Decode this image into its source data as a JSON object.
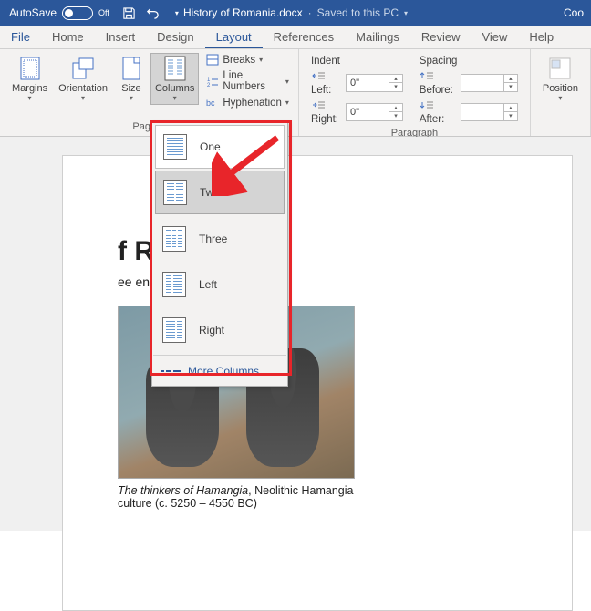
{
  "titlebar": {
    "autosave_label": "AutoSave",
    "autosave_state": "Off",
    "doc_name": "History of Romania.docx",
    "saved_status": "Saved to this PC",
    "right_text": "Coo"
  },
  "tabs": {
    "file": "File",
    "home": "Home",
    "insert": "Insert",
    "design": "Design",
    "layout": "Layout",
    "references": "References",
    "mailings": "Mailings",
    "review": "Review",
    "view": "View",
    "help": "Help"
  },
  "ribbon": {
    "page_setup": {
      "margins": "Margins",
      "orientation": "Orientation",
      "size": "Size",
      "columns": "Columns",
      "breaks": "Breaks",
      "line_numbers": "Line Numbers",
      "hyphenation": "Hyphenation",
      "group_label": "Page S"
    },
    "paragraph": {
      "indent_label": "Indent",
      "spacing_label": "Spacing",
      "left_label": "Left:",
      "right_label": "Right:",
      "before_label": "Before:",
      "after_label": "After:",
      "left_val": "0\"",
      "right_val": "0\"",
      "before_val": "",
      "after_val": "",
      "group_label": "Paragraph"
    },
    "arrange": {
      "position": "Position"
    }
  },
  "columns_menu": {
    "one": "One",
    "two": "Two",
    "three": "Three",
    "left": "Left",
    "right": "Right",
    "more": "More Columns..."
  },
  "document": {
    "heading_suffix": "f Romania",
    "subtitle_suffix": "ee encyclopedia",
    "caption_italic": "The thinkers of Hamangia",
    "caption_rest": ", Neolithic Hamangia culture (c. 5250 – 4550 BC)"
  }
}
